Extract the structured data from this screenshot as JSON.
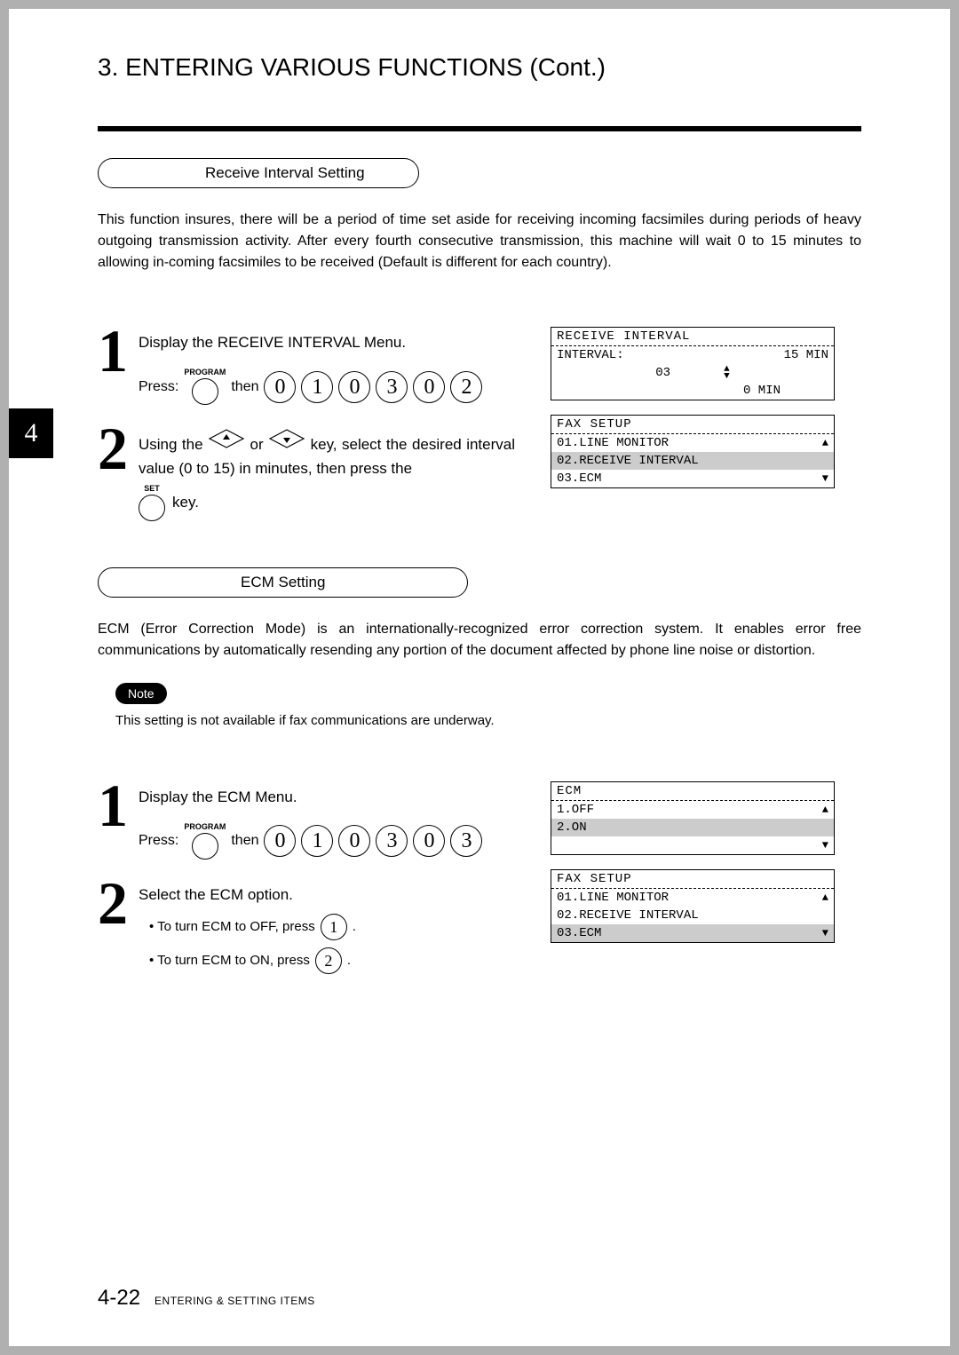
{
  "chapter_tab": "4",
  "chapter_title": "3. ENTERING VARIOUS FUNCTIONS (Cont.)",
  "section_a": {
    "heading": "Receive Interval Setting",
    "intro": "This function insures, there will be a period of time set aside for receiving incoming facsimiles during periods of heavy outgoing transmission activity. After every fourth consecutive transmission, this machine will wait 0 to 15 minutes to allowing in-coming facsimiles to be received (Default is different for each country).",
    "step1": {
      "text": "Display the RECEIVE INTERVAL Menu.",
      "press": "Press:",
      "then": "then",
      "program_label": "PROGRAM",
      "keys": [
        "0",
        "1",
        "0",
        "3",
        "0",
        "2"
      ]
    },
    "step2": {
      "text_a": "Using the ",
      "text_b": " or ",
      "text_c": " key, select the desired interval value (0 to 15) in minutes, then press the",
      "text_d": "key.",
      "set_label": "SET"
    },
    "lcd1": {
      "title": "RECEIVE INTERVAL",
      "line1_left": "INTERVAL:",
      "line1_right": "15 MIN",
      "line2_center": "03",
      "line3_right": "0 MIN"
    },
    "lcd2": {
      "title": "FAX SETUP",
      "items": [
        "01.LINE MONITOR",
        "02.RECEIVE INTERVAL",
        "03.ECM"
      ],
      "highlight_index": 1
    }
  },
  "section_b": {
    "heading": "ECM Setting",
    "intro": "ECM (Error Correction Mode) is an internationally-recognized error correction system.  It enables error free communications by automatically resending any portion of the document affected by phone line noise or distortion.",
    "note_label": "Note",
    "note_text": "This setting is not available if fax communications are underway.",
    "step1": {
      "text": "Display the ECM Menu.",
      "press": "Press:",
      "then": "then",
      "program_label": "PROGRAM",
      "keys": [
        "0",
        "1",
        "0",
        "3",
        "0",
        "3"
      ]
    },
    "step2": {
      "text": "Select the ECM option.",
      "bullet1_a": "• To turn ECM to OFF, press",
      "bullet1_key": "1",
      "bullet1_b": ".",
      "bullet2_a": "• To turn ECM to ON, press",
      "bullet2_key": "2",
      "bullet2_b": "."
    },
    "lcd1": {
      "title": "ECM",
      "items": [
        "1.OFF",
        "2.ON",
        ""
      ],
      "highlight_index": 1
    },
    "lcd2": {
      "title": "FAX SETUP",
      "items": [
        "01.LINE MONITOR",
        "02.RECEIVE INTERVAL",
        "03.ECM"
      ],
      "highlight_index": 2
    }
  },
  "footer": {
    "page": "4-22",
    "section": "ENTERING & SETTING ITEMS"
  }
}
